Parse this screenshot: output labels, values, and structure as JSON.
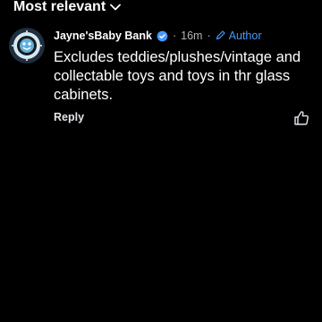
{
  "sort": {
    "label": "Most relevant",
    "icon": "chevron-down-icon"
  },
  "comment": {
    "avatar_icon": "baby-bank-logo",
    "author": "Jayne'sBaby Bank",
    "verified_icon": "verified-badge-icon",
    "separator": "·",
    "time": "16m",
    "author_tag_icon": "pencil-icon",
    "author_tag": "Author",
    "text": "Excludes teddies/plushes/vintage and collectable toys and toys in thr glass cabinets."
  },
  "actions": {
    "reply_label": "Reply",
    "like_icon": "thumbs-up-icon"
  },
  "colors": {
    "background": "#000000",
    "text": "#ffffff",
    "muted": "#b0b3b8",
    "accent": "#4599ff"
  }
}
